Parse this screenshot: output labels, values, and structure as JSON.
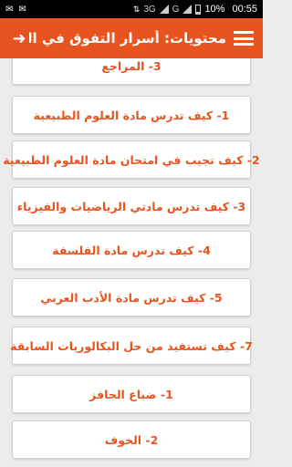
{
  "status": {
    "time": "00:55",
    "battery": "10%",
    "network": "3G",
    "network2": "G"
  },
  "appbar": {
    "title": "محتويات: أسرار التفوق في الب ..",
    "accent": "#e8541f"
  },
  "items": [
    {
      "label": "3- المراجع"
    },
    {
      "label": "1- كيف تدرس مادة العلوم الطبيعية"
    },
    {
      "label": "2- كيف تجيب في امتحان مادة العلوم الطبيعية"
    },
    {
      "label": "3- كيف تدرس مادتي الرياضيات والفيزياء"
    },
    {
      "label": "4- كيف تدرس مادة الفلسفة"
    },
    {
      "label": "5- كيف تدرس مادة الأدب العربي"
    },
    {
      "label": "7- كيف تستفيد من حل البكالوريات السابقة"
    },
    {
      "label": "1- ضياع الحافز"
    },
    {
      "label": "2- الخوف"
    }
  ]
}
